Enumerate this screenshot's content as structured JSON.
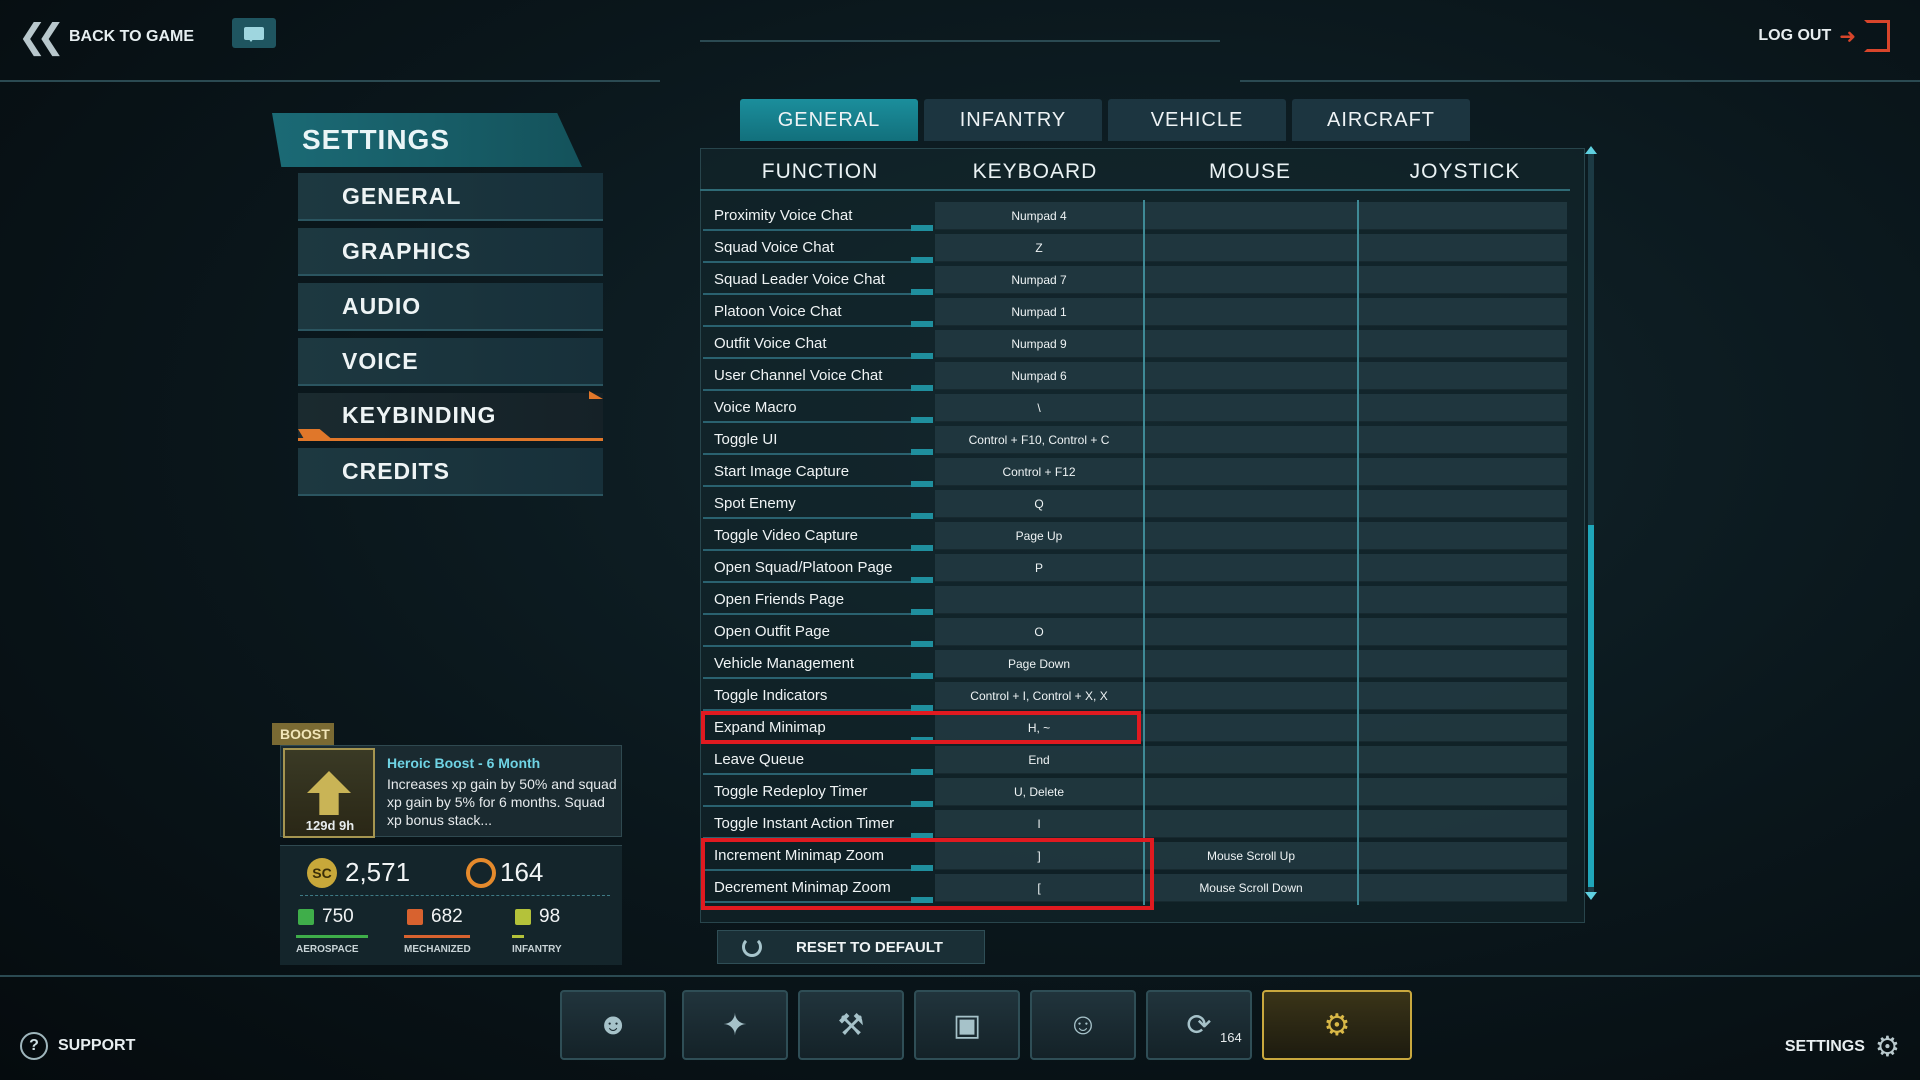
{
  "topbar": {
    "back_label": "BACK TO GAME",
    "logout_label": "LOG OUT"
  },
  "sidebar": {
    "title": "SETTINGS",
    "items": [
      {
        "label": "GENERAL"
      },
      {
        "label": "GRAPHICS"
      },
      {
        "label": "AUDIO"
      },
      {
        "label": "VOICE"
      },
      {
        "label": "KEYBINDING",
        "active": true
      },
      {
        "label": "CREDITS"
      }
    ]
  },
  "tabs": [
    {
      "label": "GENERAL",
      "active": true
    },
    {
      "label": "INFANTRY"
    },
    {
      "label": "VEHICLE"
    },
    {
      "label": "AIRCRAFT"
    }
  ],
  "columns": {
    "function": "FUNCTION",
    "keyboard": "KEYBOARD",
    "mouse": "MOUSE",
    "joystick": "JOYSTICK"
  },
  "rows": [
    {
      "function": "Proximity Voice Chat",
      "keyboard": "Numpad 4",
      "mouse": "",
      "joystick": ""
    },
    {
      "function": "Squad Voice Chat",
      "keyboard": "Z",
      "mouse": "",
      "joystick": ""
    },
    {
      "function": "Squad Leader Voice Chat",
      "keyboard": "Numpad 7",
      "mouse": "",
      "joystick": ""
    },
    {
      "function": "Platoon Voice Chat",
      "keyboard": "Numpad 1",
      "mouse": "",
      "joystick": ""
    },
    {
      "function": "Outfit Voice Chat",
      "keyboard": "Numpad 9",
      "mouse": "",
      "joystick": ""
    },
    {
      "function": "User Channel Voice Chat",
      "keyboard": "Numpad 6",
      "mouse": "",
      "joystick": ""
    },
    {
      "function": "Voice Macro",
      "keyboard": "\\",
      "mouse": "",
      "joystick": ""
    },
    {
      "function": "Toggle UI",
      "keyboard": "Control + F10, Control + C",
      "mouse": "",
      "joystick": ""
    },
    {
      "function": "Start Image Capture",
      "keyboard": "Control + F12",
      "mouse": "",
      "joystick": ""
    },
    {
      "function": "Spot Enemy",
      "keyboard": "Q",
      "mouse": "",
      "joystick": ""
    },
    {
      "function": "Toggle Video Capture",
      "keyboard": "Page Up",
      "mouse": "",
      "joystick": ""
    },
    {
      "function": "Open Squad/Platoon Page",
      "keyboard": "P",
      "mouse": "",
      "joystick": ""
    },
    {
      "function": "Open Friends Page",
      "keyboard": "",
      "mouse": "",
      "joystick": ""
    },
    {
      "function": "Open Outfit Page",
      "keyboard": "O",
      "mouse": "",
      "joystick": ""
    },
    {
      "function": "Vehicle Management",
      "keyboard": "Page Down",
      "mouse": "",
      "joystick": ""
    },
    {
      "function": "Toggle Indicators",
      "keyboard": "Control + I, Control + X, X",
      "mouse": "",
      "joystick": ""
    },
    {
      "function": "Expand Minimap",
      "keyboard": "H, ~",
      "mouse": "",
      "joystick": ""
    },
    {
      "function": "Leave Queue",
      "keyboard": "End",
      "mouse": "",
      "joystick": ""
    },
    {
      "function": "Toggle Redeploy Timer",
      "keyboard": "U, Delete",
      "mouse": "",
      "joystick": ""
    },
    {
      "function": "Toggle Instant Action Timer",
      "keyboard": "I",
      "mouse": "",
      "joystick": ""
    },
    {
      "function": "Increment Minimap Zoom",
      "keyboard": "]",
      "mouse": "Mouse Scroll Up",
      "joystick": ""
    },
    {
      "function": "Decrement Minimap Zoom",
      "keyboard": "[",
      "mouse": "Mouse Scroll Down",
      "joystick": ""
    }
  ],
  "reset_label": "RESET TO DEFAULT",
  "boost": {
    "tag": "BOOST",
    "title": "Heroic Boost - 6 Month",
    "description": "Increases xp gain by 50% and squad xp gain by 5% for 6 months.  Squad xp bonus stack...",
    "time_left": "129d 9h"
  },
  "currency": {
    "sc": "2,571",
    "certs": "164",
    "resources": [
      {
        "value": "750",
        "label": "AEROSPACE",
        "color": "#3fae4a"
      },
      {
        "value": "682",
        "label": "MECHANIZED",
        "color": "#d8622f"
      },
      {
        "value": "98",
        "label": "INFANTRY",
        "color": "#b4c23a"
      }
    ]
  },
  "bottom_nav": {
    "cert_count": "164",
    "icons": [
      "character-icon",
      "map-icon",
      "weapon-icon",
      "vehicle-icon",
      "squad-icon",
      "certs-icon",
      "settings-icon"
    ]
  },
  "support_label": "SUPPORT",
  "settings_label": "SETTINGS",
  "colors": {
    "accent": "#1b8e9c",
    "active_orange": "#e0772a",
    "highlight_red": "#e01a20"
  }
}
